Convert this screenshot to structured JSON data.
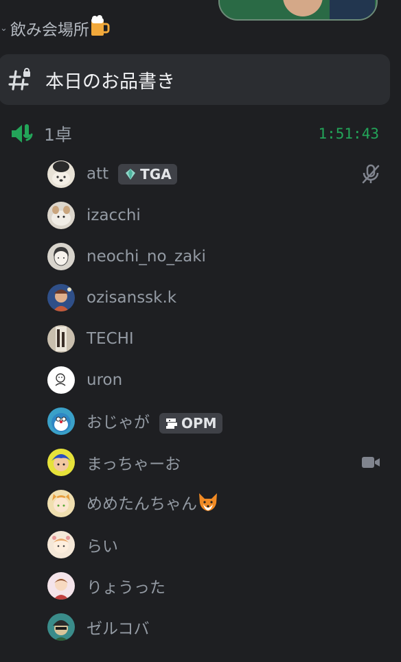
{
  "category": {
    "name": "飲み会場所"
  },
  "text_channel": {
    "name": "本日のお品書き"
  },
  "voice_channel": {
    "name": "1卓",
    "timer": "1:51:43"
  },
  "members": [
    {
      "name": "att",
      "tag": "TGA",
      "status_icon": "mic-muted-icon",
      "avatar_bg": "#e8e2d6",
      "avatar_fg": "#2a2a2a"
    },
    {
      "name": "izacchi",
      "avatar_bg": "#dcd6cc",
      "avatar_fg": "#b89a77"
    },
    {
      "name": "neochi_no_zaki",
      "avatar_bg": "#d8d4cc",
      "avatar_fg": "#4a4a4a"
    },
    {
      "name": "ozisanssk.k",
      "avatar_bg": "#2f4f88",
      "avatar_fg": "#c45a3a"
    },
    {
      "name": "TECHI",
      "avatar_bg": "#c9bfae",
      "avatar_fg": "#3b2f28"
    },
    {
      "name": "uron",
      "avatar_bg": "#ffffff",
      "avatar_fg": "#333333"
    },
    {
      "name": "おじゃが",
      "tag": "OPM",
      "avatar_bg": "#3aa0c8",
      "avatar_fg": "#ffffff"
    },
    {
      "name": "まっちゃーお",
      "status_icon": "video-camera-icon",
      "avatar_bg": "#e6e23a",
      "avatar_fg": "#2a4fc0"
    },
    {
      "name": "めめたんちゃん",
      "emoji": "fox-emoji",
      "avatar_bg": "#f0dfb0",
      "avatar_fg": "#e8a040"
    },
    {
      "name": "らい",
      "avatar_bg": "#f5e8d8",
      "avatar_fg": "#e89a9a"
    },
    {
      "name": "りょうった",
      "avatar_bg": "#f4e4ea",
      "avatar_fg": "#c04040"
    },
    {
      "name": "ゼルコバ",
      "avatar_bg": "#3a8c8a",
      "avatar_fg": "#2a2a2a"
    }
  ],
  "colors": {
    "bg": "#1e1f22",
    "accent_green": "#23a559",
    "text_muted": "#949ba4",
    "tag_bg": "#3f4147"
  }
}
